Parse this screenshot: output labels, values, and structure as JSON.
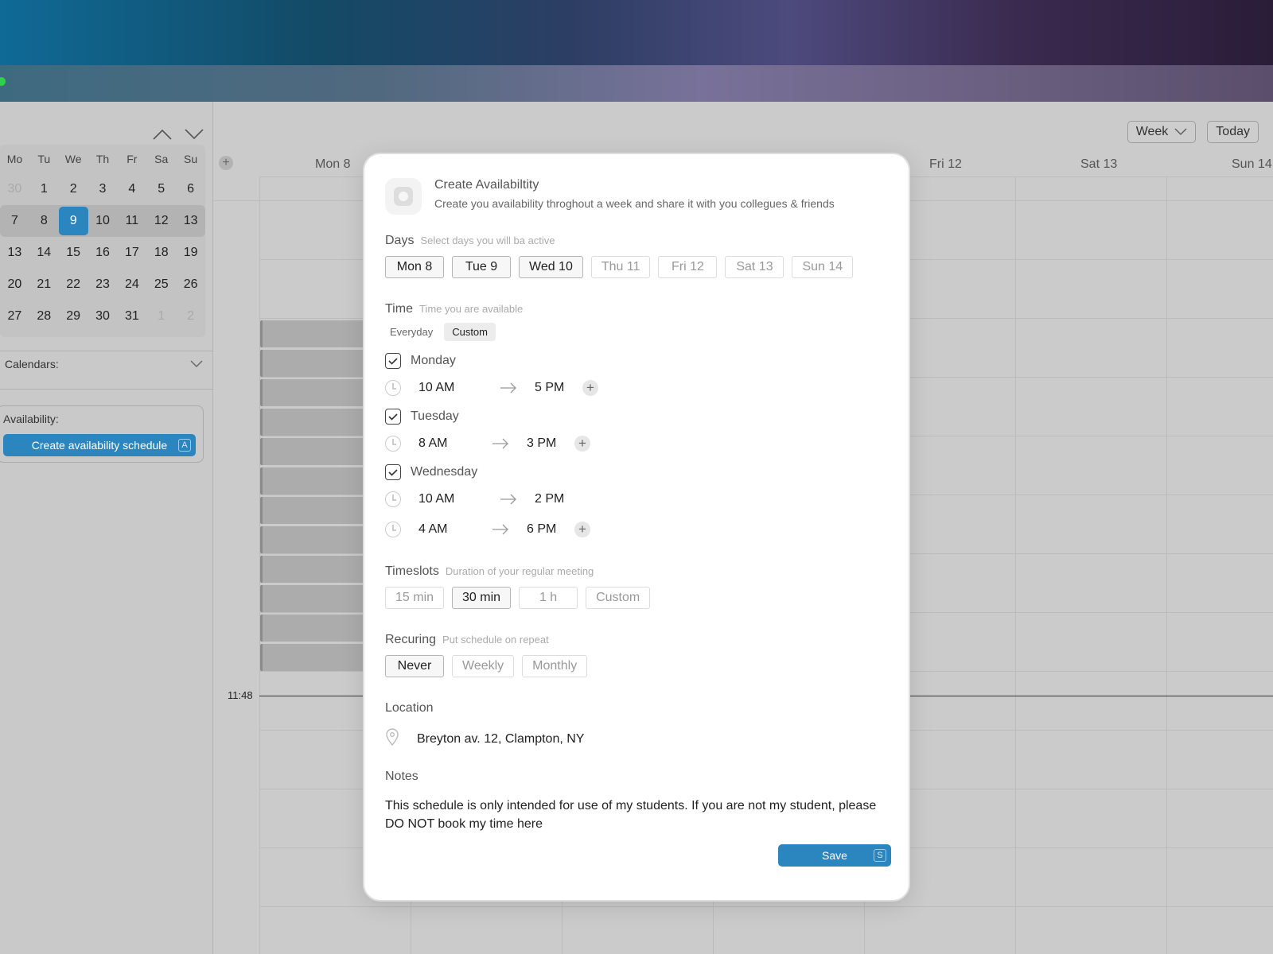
{
  "sidebar": {
    "weekdays": [
      "Mo",
      "Tu",
      "We",
      "Th",
      "Fr",
      "Sa",
      "Su"
    ],
    "weeks": [
      [
        "30",
        "1",
        "2",
        "3",
        "4",
        "5",
        "6"
      ],
      [
        "7",
        "8",
        "9",
        "10",
        "11",
        "12",
        "13"
      ],
      [
        "13",
        "14",
        "15",
        "16",
        "17",
        "18",
        "19"
      ],
      [
        "20",
        "21",
        "22",
        "23",
        "24",
        "25",
        "26"
      ],
      [
        "27",
        "28",
        "29",
        "30",
        "31",
        "1",
        "2"
      ]
    ],
    "calendars_label": "Calendars:",
    "availability_label": "Availability:",
    "create_button": "Create availability schedule",
    "create_shortcut": "A"
  },
  "toolbar": {
    "view_label": "Week",
    "today_label": "Today"
  },
  "week_header": {
    "days": [
      "Mon 8",
      "Fri 12",
      "Sat 13",
      "Sun 14"
    ]
  },
  "now_time": "11:48",
  "modal": {
    "title": "Create Availabiltity",
    "subtitle": "Create you availability throghout a week and share it with you collegues & friends",
    "days": {
      "label": "Days",
      "hint": "Select days you will ba active",
      "options": [
        "Mon 8",
        "Tue 9",
        "Wed 10",
        "Thu 11",
        "Fri 12",
        "Sat 13",
        "Sun 14"
      ]
    },
    "time": {
      "label": "Time",
      "hint": "Time you are available",
      "modes": [
        "Everyday",
        "Custom"
      ],
      "schedule": [
        {
          "day": "Monday",
          "start": "10 AM",
          "end": "5 PM"
        },
        {
          "day": "Tuesday",
          "start": "8 AM",
          "end": "3 PM"
        },
        {
          "day": "Wednesday",
          "start": "10 AM",
          "end": "2 PM",
          "start2": "4 AM",
          "end2": "6 PM"
        }
      ]
    },
    "timeslots": {
      "label": "Timeslots",
      "hint": "Duration of your regular meeting",
      "options": [
        "15 min",
        "30 min",
        "1 h",
        "Custom"
      ]
    },
    "recurring": {
      "label": "Recuring",
      "hint": "Put schedule on repeat",
      "options": [
        "Never",
        "Weekly",
        "Monthly"
      ]
    },
    "location": {
      "label": "Location",
      "value": "Breyton av. 12, Clampton, NY"
    },
    "notes": {
      "label": "Notes",
      "value": "This schedule is only intended for use of my students. If you are not my student, please DO NOT book my time here"
    },
    "save_label": "Save",
    "save_shortcut": "S"
  },
  "colors": {
    "accent": "#2b86bf"
  }
}
